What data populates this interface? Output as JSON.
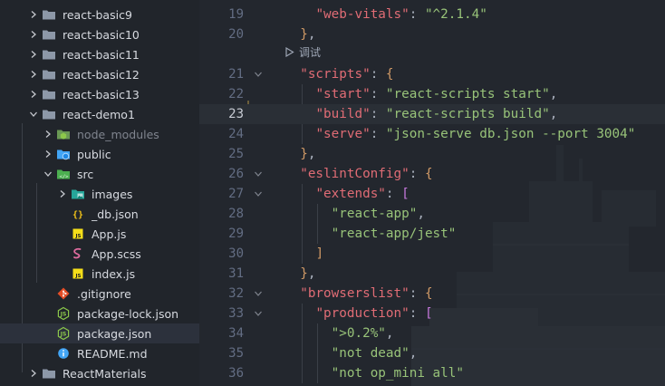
{
  "explorer": {
    "items": [
      {
        "label": "react-basic9",
        "kind": "folder",
        "state": "collapsed",
        "depth": 0
      },
      {
        "label": "react-basic10",
        "kind": "folder",
        "state": "collapsed",
        "depth": 0
      },
      {
        "label": "react-basic11",
        "kind": "folder",
        "state": "collapsed",
        "depth": 0
      },
      {
        "label": "react-basic12",
        "kind": "folder",
        "state": "collapsed",
        "depth": 0
      },
      {
        "label": "react-basic13",
        "kind": "folder",
        "state": "collapsed",
        "depth": 0
      },
      {
        "label": "react-demo1",
        "kind": "folder",
        "state": "expanded",
        "depth": 0
      },
      {
        "label": "node_modules",
        "kind": "node-folder",
        "state": "collapsed",
        "depth": 1,
        "dim": true
      },
      {
        "label": "public",
        "kind": "public-folder",
        "state": "collapsed",
        "depth": 1
      },
      {
        "label": "src",
        "kind": "src-folder",
        "state": "expanded",
        "depth": 1
      },
      {
        "label": "images",
        "kind": "images-folder",
        "state": "collapsed",
        "depth": 2
      },
      {
        "label": "_db.json",
        "kind": "json-file",
        "depth": 2
      },
      {
        "label": "App.js",
        "kind": "js-file",
        "depth": 2
      },
      {
        "label": "App.scss",
        "kind": "scss-file",
        "depth": 2
      },
      {
        "label": "index.js",
        "kind": "js-file",
        "depth": 2
      },
      {
        "label": ".gitignore",
        "kind": "git-file",
        "depth": 1
      },
      {
        "label": "package-lock.json",
        "kind": "npm-file",
        "depth": 1
      },
      {
        "label": "package.json",
        "kind": "npm-file",
        "depth": 1,
        "selected": true
      },
      {
        "label": "README.md",
        "kind": "info-file",
        "depth": 1
      },
      {
        "label": "ReactMaterials",
        "kind": "folder",
        "state": "collapsed",
        "depth": 0
      }
    ]
  },
  "editor": {
    "codelens_label": "调试",
    "current_line": 23,
    "lines": [
      {
        "num": "19",
        "text": "    \"web-vitals\": \"^2.1.4\""
      },
      {
        "num": "20",
        "text": "  },"
      },
      {
        "num": "21",
        "text": "  \"scripts\": {"
      },
      {
        "num": "22",
        "text": "    \"start\": \"react-scripts start\","
      },
      {
        "num": "23",
        "text": "    \"build\": \"react-scripts build\","
      },
      {
        "num": "24",
        "text": "    \"serve\": \"json-serve db.json --port 3004\""
      },
      {
        "num": "25",
        "text": "  },"
      },
      {
        "num": "26",
        "text": "  \"eslintConfig\": {"
      },
      {
        "num": "27",
        "text": "    \"extends\": ["
      },
      {
        "num": "28",
        "text": "      \"react-app\","
      },
      {
        "num": "29",
        "text": "      \"react-app/jest\""
      },
      {
        "num": "30",
        "text": "    ]"
      },
      {
        "num": "31",
        "text": "  },"
      },
      {
        "num": "32",
        "text": "  \"browserslist\": {"
      },
      {
        "num": "33",
        "text": "    \"production\": ["
      },
      {
        "num": "34",
        "text": "      \">0.2%\","
      },
      {
        "num": "35",
        "text": "      \"not dead\","
      },
      {
        "num": "36",
        "text": "      \"not op_mini all\""
      }
    ]
  },
  "colors": {
    "key": "#e06c75",
    "string": "#98c379",
    "bracket_level1": "#d19a66",
    "bracket_level2": "#c678dd",
    "bracket_level3": "#61afef",
    "folder": "#8d98a8",
    "selection": "#2c313c"
  }
}
